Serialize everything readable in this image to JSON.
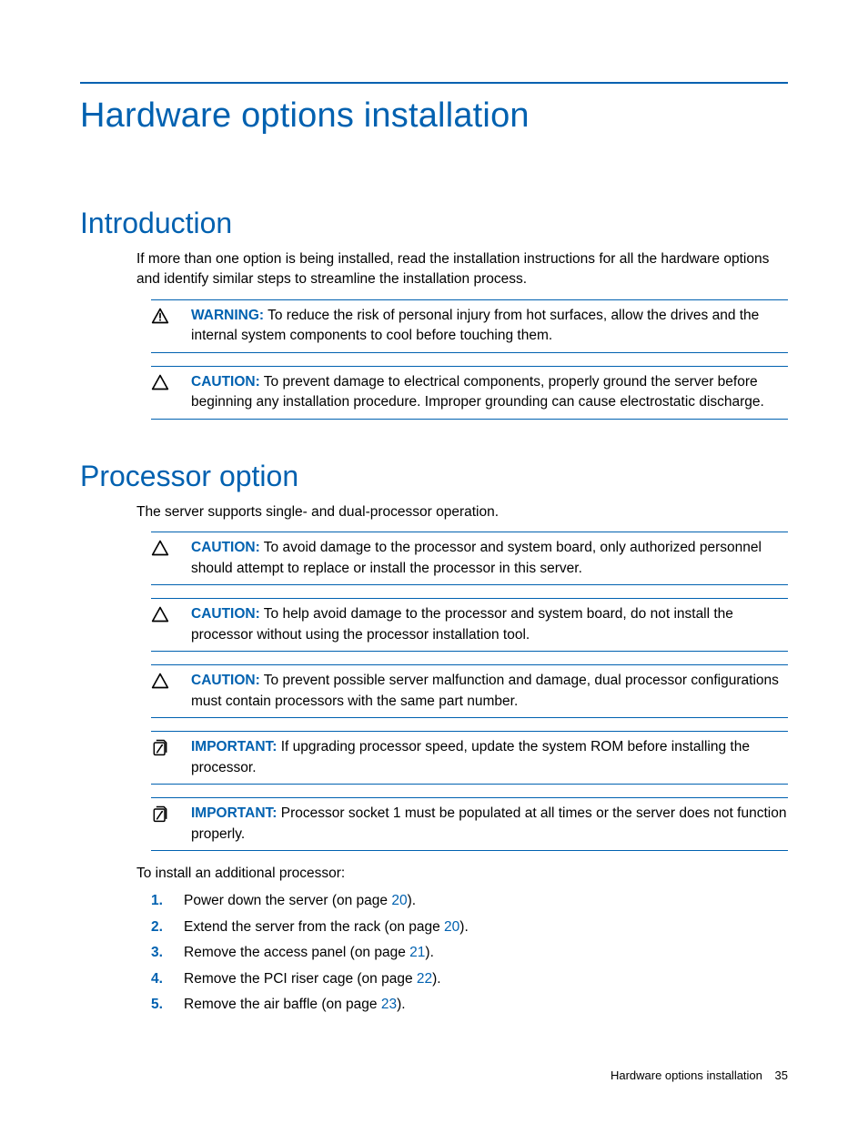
{
  "title": "Hardware options installation",
  "sections": {
    "intro": {
      "heading": "Introduction",
      "para": "If more than one option is being installed, read the installation instructions for all the hardware options and identify similar steps to streamline the installation process.",
      "callouts": [
        {
          "type": "warning",
          "label": "WARNING:",
          "text": " To reduce the risk of personal injury from hot surfaces, allow the drives and the internal system components to cool before touching them."
        },
        {
          "type": "caution",
          "label": "CAUTION:",
          "text": " To prevent damage to electrical components, properly ground the server before beginning any installation procedure. Improper grounding can cause electrostatic discharge."
        }
      ]
    },
    "processor": {
      "heading": "Processor option",
      "para": "The server supports single- and dual-processor operation.",
      "callouts": [
        {
          "type": "caution",
          "label": "CAUTION:",
          "text": " To avoid damage to the processor and system board, only authorized personnel should attempt to replace or install the processor in this server."
        },
        {
          "type": "caution",
          "label": "CAUTION:",
          "text": " To help avoid damage to the processor and system board, do not install the processor without using the processor installation tool."
        },
        {
          "type": "caution",
          "label": "CAUTION:",
          "text": " To prevent possible server malfunction and damage, dual processor configurations must contain processors with the same part number."
        },
        {
          "type": "important",
          "label": "IMPORTANT:",
          "text": " If upgrading processor speed, update the system ROM before installing the processor."
        },
        {
          "type": "important",
          "label": "IMPORTANT:",
          "text": " Processor socket 1 must be populated at all times or the server does not function properly."
        }
      ],
      "lead_in": "To install an additional processor:",
      "steps": [
        {
          "pre": "Power down the server (on page ",
          "page": "20",
          "post": ")."
        },
        {
          "pre": "Extend the server from the rack (on page ",
          "page": "20",
          "post": ")."
        },
        {
          "pre": "Remove the access panel (on page ",
          "page": "21",
          "post": ")."
        },
        {
          "pre": "Remove the PCI riser cage (on page ",
          "page": "22",
          "post": ")."
        },
        {
          "pre": "Remove the air baffle (on page ",
          "page": "23",
          "post": ")."
        }
      ]
    }
  },
  "footer": {
    "section": "Hardware options installation",
    "page": "35"
  }
}
